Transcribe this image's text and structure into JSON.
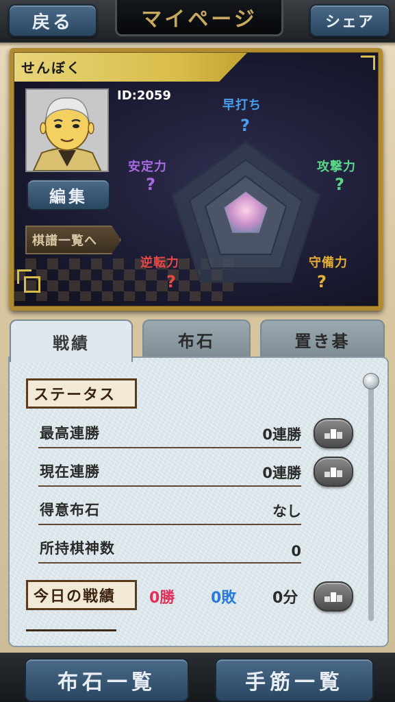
{
  "header": {
    "back_label": "戻る",
    "title": "マイページ",
    "share_label": "シェア"
  },
  "profile": {
    "name": "せんぼく",
    "id_text": "ID:2059",
    "edit_label": "編集",
    "kifu_list_label": "棋譜一覧へ",
    "stats": [
      {
        "label": "早打ち",
        "value": "?",
        "color": "#4aa0f0"
      },
      {
        "label": "攻撃力",
        "value": "?",
        "color": "#5ad88a"
      },
      {
        "label": "守備力",
        "value": "?",
        "color": "#e8b030"
      },
      {
        "label": "逆転力",
        "value": "?",
        "color": "#e84848"
      },
      {
        "label": "安定力",
        "value": "?",
        "color": "#a86ae0"
      }
    ]
  },
  "tabs": [
    {
      "label": "戦績",
      "active": true
    },
    {
      "label": "布石",
      "active": false
    },
    {
      "label": "置き碁",
      "active": false
    }
  ],
  "status": {
    "heading": "ステータス",
    "rows": [
      {
        "label": "最高連勝",
        "value": "0連勝",
        "has_rank_button": true
      },
      {
        "label": "現在連勝",
        "value": "0連勝",
        "has_rank_button": true
      },
      {
        "label": "得意布石",
        "value": "なし",
        "has_rank_button": false
      },
      {
        "label": "所持棋神数",
        "value": "0",
        "has_rank_button": false
      }
    ]
  },
  "today": {
    "heading": "今日の戦績",
    "wins": "0勝",
    "losses": "0敗",
    "draws": "0分"
  },
  "bottom": {
    "fuseki_list_label": "布石一覧",
    "tesuji_list_label": "手筋一覧"
  }
}
